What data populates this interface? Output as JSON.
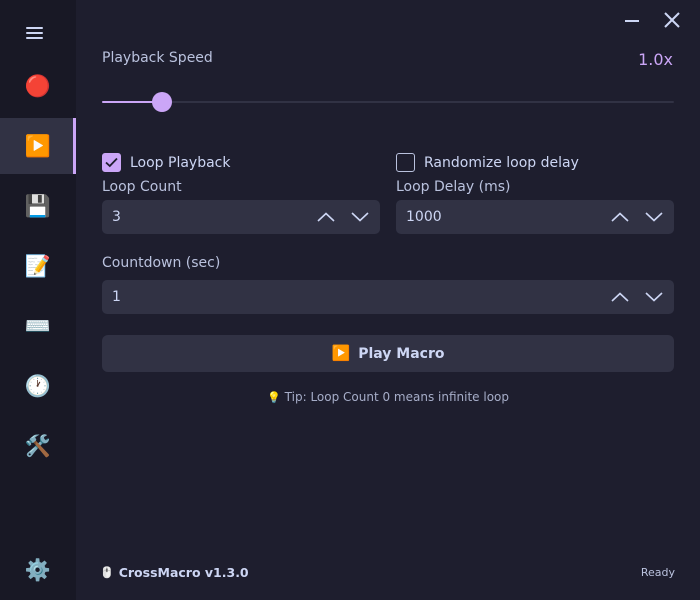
{
  "sidebar": {
    "items": [
      {
        "name": "record",
        "icon": "🔴"
      },
      {
        "name": "play",
        "icon": "▶️",
        "active": true
      },
      {
        "name": "save",
        "icon": "💾"
      },
      {
        "name": "edit",
        "icon": "📝"
      },
      {
        "name": "keyboard",
        "icon": "⌨️"
      },
      {
        "name": "schedule",
        "icon": "🕐"
      },
      {
        "name": "tools",
        "icon": "🛠️"
      }
    ],
    "settings_icon": "⚙️"
  },
  "playback_speed": {
    "label": "Playback Speed",
    "value": "1.0x",
    "slider_fraction": 0.105
  },
  "loop_playback": {
    "label": "Loop Playback",
    "checked": true
  },
  "randomize_delay": {
    "label": "Randomize loop delay",
    "checked": false
  },
  "loop_count": {
    "label": "Loop Count",
    "value": "3"
  },
  "loop_delay": {
    "label": "Loop Delay (ms)",
    "value": "1000"
  },
  "countdown": {
    "label": "Countdown (sec)",
    "value": "1"
  },
  "play_button": {
    "icon": "▶️",
    "label": "Play Macro"
  },
  "tip": {
    "icon": "💡",
    "text": "Tip: Loop Count 0 means infinite loop"
  },
  "footer": {
    "icon": "🖱️",
    "brand": "CrossMacro v1.3.0",
    "status": "Ready"
  },
  "colors": {
    "accent": "#cba6f7",
    "background": "#1e1e2e",
    "sidebar": "#181825",
    "surface": "#313244"
  }
}
